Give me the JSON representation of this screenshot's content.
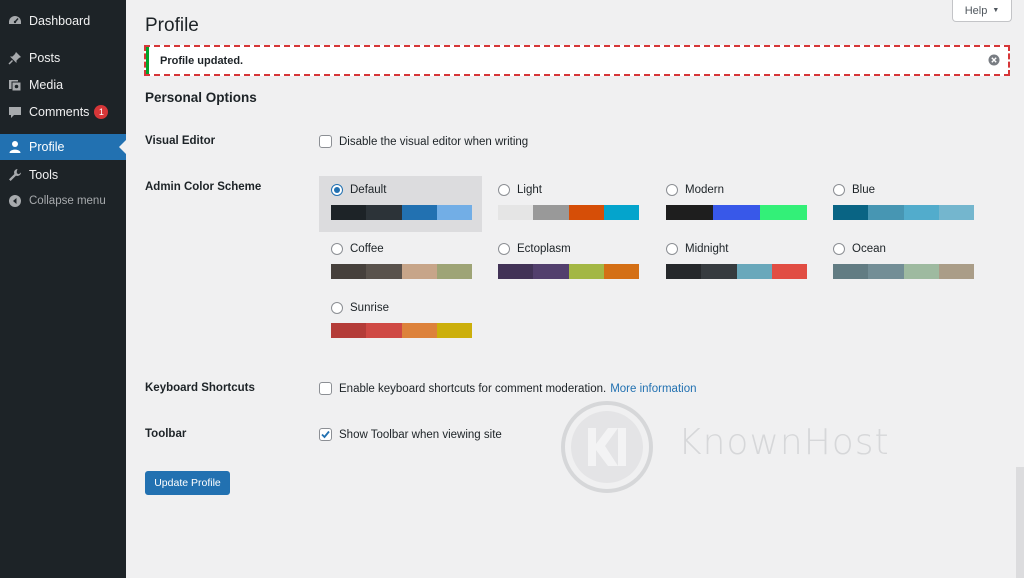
{
  "sidebar": {
    "items": [
      {
        "label": "Dashboard",
        "icon": "dashboard-icon"
      },
      {
        "label": "Posts",
        "icon": "pin-icon"
      },
      {
        "label": "Media",
        "icon": "media-icon"
      },
      {
        "label": "Comments",
        "icon": "comment-icon",
        "badge": "1"
      },
      {
        "label": "Profile",
        "icon": "user-icon"
      },
      {
        "label": "Tools",
        "icon": "wrench-icon"
      },
      {
        "label": "Collapse menu",
        "icon": "collapse-icon"
      }
    ]
  },
  "header": {
    "title": "Profile",
    "help_label": "Help"
  },
  "notice": {
    "message": "Profile updated."
  },
  "personal_options": {
    "title": "Personal Options",
    "visual_editor": {
      "label": "Visual Editor",
      "checkbox_label": "Disable the visual editor when writing",
      "checked": false
    },
    "admin_color_scheme": {
      "label": "Admin Color Scheme",
      "selected": "Default",
      "schemes": [
        {
          "name": "Default",
          "colors": [
            "#1d2327",
            "#2c3338",
            "#2271b1",
            "#72aee6"
          ]
        },
        {
          "name": "Light",
          "colors": [
            "#e5e5e5",
            "#999999",
            "#d64e07",
            "#04a4cc"
          ]
        },
        {
          "name": "Modern",
          "colors": [
            "#1e1e1e",
            "#3858e9",
            "#33f078"
          ]
        },
        {
          "name": "Blue",
          "colors": [
            "#096484",
            "#4796b3",
            "#52accc",
            "#74b6ce"
          ]
        },
        {
          "name": "Coffee",
          "colors": [
            "#46403c",
            "#59524c",
            "#c7a589",
            "#9ea476"
          ]
        },
        {
          "name": "Ectoplasm",
          "colors": [
            "#413256",
            "#523f6d",
            "#a3b745",
            "#d46f15"
          ]
        },
        {
          "name": "Midnight",
          "colors": [
            "#25282b",
            "#363b3f",
            "#69a8bb",
            "#e14d43"
          ]
        },
        {
          "name": "Ocean",
          "colors": [
            "#627c83",
            "#738e96",
            "#9ebaa0",
            "#aa9d88"
          ]
        },
        {
          "name": "Sunrise",
          "colors": [
            "#b43c38",
            "#cf4944",
            "#dd823b",
            "#ccaf0b"
          ]
        }
      ]
    },
    "keyboard_shortcuts": {
      "label": "Keyboard Shortcuts",
      "checkbox_label": "Enable keyboard shortcuts for comment moderation.",
      "link_label": "More information",
      "checked": false
    },
    "toolbar": {
      "label": "Toolbar",
      "checkbox_label": "Show Toolbar when viewing site",
      "checked": true
    }
  },
  "actions": {
    "update_label": "Update Profile"
  },
  "watermark": {
    "text": "KnownHost"
  },
  "colors": {
    "sidebar_bg": "#1d2327",
    "accent": "#2271b1",
    "badge": "#d63638",
    "notice_border": "#d63638",
    "success": "#00a32a"
  }
}
